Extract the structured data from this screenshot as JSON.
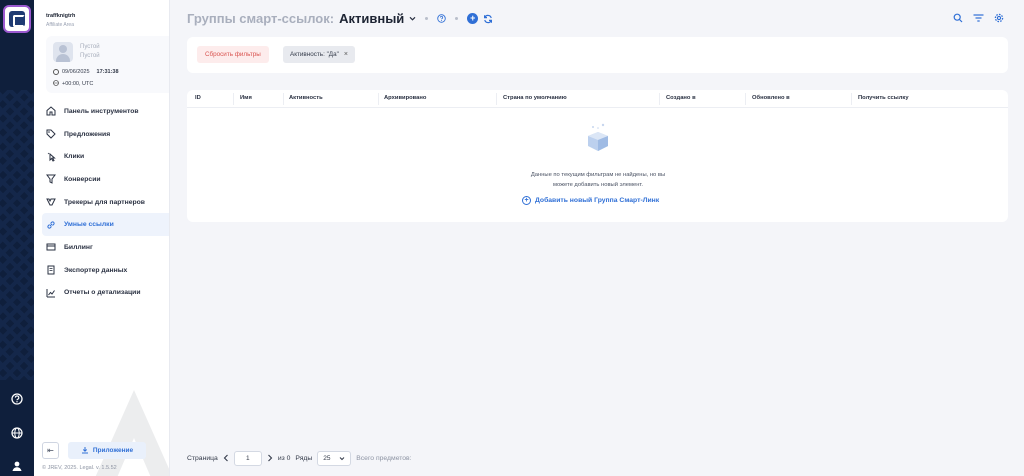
{
  "app": {
    "brand_title": "traffknigtrh",
    "brand_sub": "Affiliate Area",
    "accent": "#2f6fd6"
  },
  "user": {
    "name_line1": "Пустой",
    "name_line2": "Пустой",
    "date": "09/06/2025",
    "time": "17:31:38",
    "timezone": "+00:00, UTC"
  },
  "nav": {
    "items": [
      {
        "label": "Панель инструментов",
        "icon": "dashboard-icon"
      },
      {
        "label": "Предложения",
        "icon": "tag-icon"
      },
      {
        "label": "Клики",
        "icon": "click-icon"
      },
      {
        "label": "Конверсии",
        "icon": "funnel-icon"
      },
      {
        "label": "Трекеры для партнеров",
        "icon": "tracker-icon"
      },
      {
        "label": "Умные ссылки",
        "icon": "link-icon"
      },
      {
        "label": "Биллинг",
        "icon": "billing-icon"
      },
      {
        "label": "Экспортер данных",
        "icon": "export-icon"
      },
      {
        "label": "Отчеты о детализации",
        "icon": "chart-icon"
      }
    ],
    "active_index": 5
  },
  "footer": {
    "app_button": "Приложение",
    "copyright": "© JREV, 2025. Legal. v. 1.5.52"
  },
  "header": {
    "title_muted": "Группы смарт-ссылок:",
    "title_strong": "Активный"
  },
  "filters": {
    "reset_label": "Сбросить фильтры",
    "chip_label": "Активность: \"Да\"",
    "chip_close": "×"
  },
  "table": {
    "columns": [
      "ID",
      "Имя",
      "Активность",
      "Архивировано",
      "Страна по умолчанию",
      "Создано в",
      "Обновлено в",
      "Получить ссылку"
    ],
    "empty_line1": "Данные по текущим фильтрам не найдены, но вы",
    "empty_line2": "можете добавить новый элемент.",
    "add_link": "Добавить новый Группа Смарт-Линк"
  },
  "pager": {
    "page_label": "Страница",
    "page_value": "1",
    "of_label": "из 0",
    "rows_label": "Ряды",
    "rows_value": "25",
    "total_label": "Всего предметов:"
  }
}
